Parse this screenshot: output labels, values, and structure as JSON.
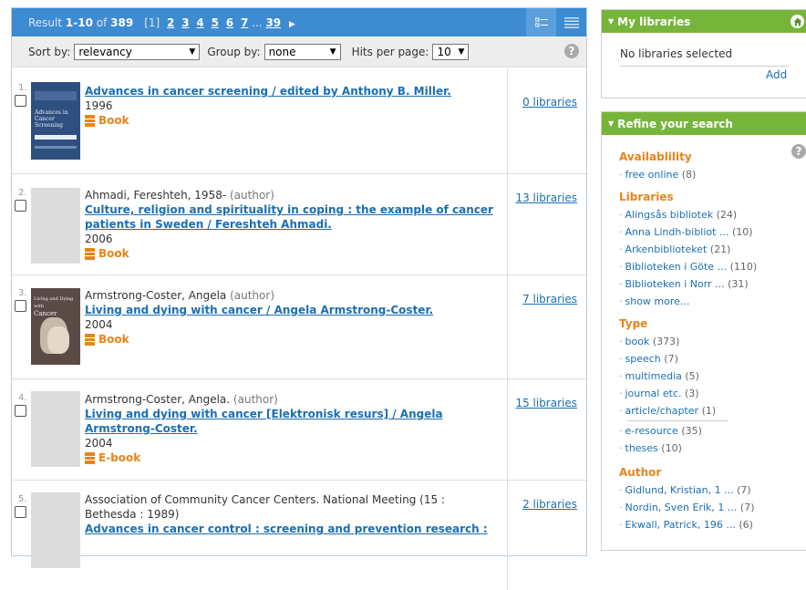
{
  "results_header": {
    "result_prefix": "Result ",
    "result_range": "1-10",
    "result_of": " of ",
    "result_total": "389",
    "current_page": "[1]",
    "pages": [
      "2",
      "3",
      "4",
      "5",
      "6",
      "7"
    ],
    "ellipsis": "...",
    "last_page": "39"
  },
  "sortbar": {
    "sort_label": "Sort by:",
    "sort_value": "relevancy",
    "group_label": "Group by:",
    "group_value": "none",
    "hits_label": "Hits per page:",
    "hits_value": "10"
  },
  "results": [
    {
      "num": "1.",
      "author": "",
      "role": "",
      "title": "Advances in cancer screening / edited by Anthony B. Miller.",
      "year": "1996",
      "format": "Book",
      "libraries": "0 libraries",
      "cover": "book-cover-advances"
    },
    {
      "num": "2.",
      "author": "Ahmadi, Fereshteh, 1958-",
      "role": "(author)",
      "title": "Culture, religion and spirituality in coping : the example of cancer patients in Sweden / Fereshteh Ahmadi.",
      "year": "2006",
      "format": "Book",
      "libraries": "13 libraries",
      "cover": "placeholder"
    },
    {
      "num": "3.",
      "author": "Armstrong-Coster, Angela",
      "role": "(author)",
      "title": "Living and dying with cancer / Angela Armstrong-Coster.",
      "year": "2004",
      "format": "Book",
      "libraries": "7 libraries",
      "cover": "book-cover-living"
    },
    {
      "num": "4.",
      "author": "Armstrong-Coster, Angela.",
      "role": "(author)",
      "title": "Living and dying with cancer [Elektronisk resurs] / Angela Armstrong-Coster.",
      "year": "2004",
      "format": "E-book",
      "libraries": "15 libraries",
      "cover": "placeholder"
    },
    {
      "num": "5.",
      "author": "Association of Community Cancer Centers. National Meeting (15 : Bethesda : 1989)",
      "role": "",
      "title": "Advances in cancer control : screening and prevention research :",
      "year": "",
      "format": "",
      "libraries": "2 libraries",
      "cover": "placeholder"
    }
  ],
  "cover1_text": {
    "line1": "Advances in",
    "line2": "Cancer Screening"
  },
  "cover3_text": {
    "line1": "Living and Dying with",
    "line2": "Cancer"
  },
  "my_libraries": {
    "title": "My libraries",
    "text": "No libraries selected",
    "add": "Add"
  },
  "refine": {
    "title": "Refine your search",
    "facets": [
      {
        "title": "Availablility",
        "items": [
          {
            "label": "free online",
            "count": "(8)"
          }
        ]
      },
      {
        "title": "Libraries",
        "items": [
          {
            "label": "Alingsås bibliotek",
            "count": "(24)"
          },
          {
            "label": "Anna Lindh-bibliot ...",
            "count": "(10)"
          },
          {
            "label": "Arkenbiblioteket",
            "count": "(21)"
          },
          {
            "label": "Biblioteken i Göte ...",
            "count": "(110)"
          },
          {
            "label": "Biblioteken i Norr ...",
            "count": "(31)"
          },
          {
            "label": "show more...",
            "count": ""
          }
        ]
      },
      {
        "title": "Type",
        "items": [
          {
            "label": "book",
            "count": "(373)"
          },
          {
            "label": "speech",
            "count": "(7)"
          },
          {
            "label": "multimedia",
            "count": "(5)"
          },
          {
            "label": "journal etc.",
            "count": "(3)"
          },
          {
            "label": "article/chapter",
            "count": "(1)"
          },
          {
            "label": "e-resource",
            "count": "(35)"
          },
          {
            "label": "theses",
            "count": "(10)"
          }
        ]
      },
      {
        "title": "Author",
        "items": [
          {
            "label": "Gidlund, Kristian, 1 ...",
            "count": "(7)"
          },
          {
            "label": "Nordin, Sven Erik, 1 ...",
            "count": "(7)"
          },
          {
            "label": "Ekwall, Patrick, 196 ...",
            "count": "(6)"
          }
        ]
      }
    ]
  },
  "colors": {
    "header_blue": "#3d8bd0",
    "link": "#1a6fb3",
    "facet_orange": "#e8841a",
    "sidebar_green": "#77b53a"
  }
}
